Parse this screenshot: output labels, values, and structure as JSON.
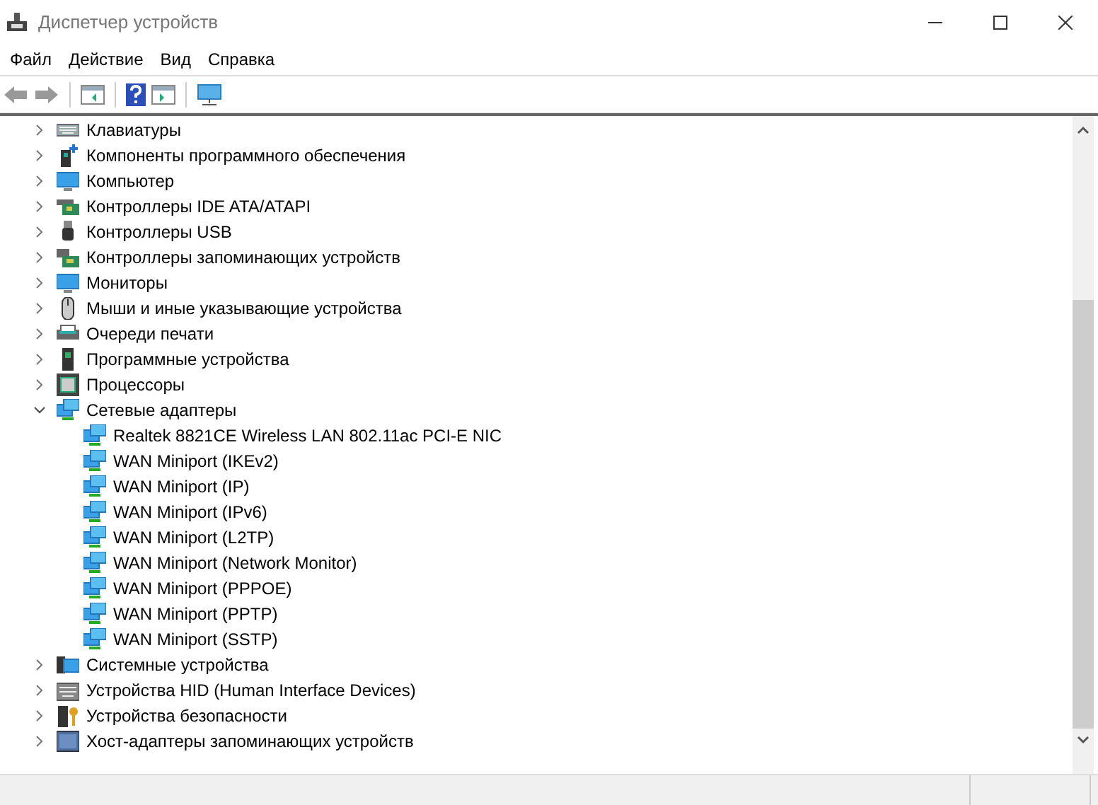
{
  "window": {
    "title": "Диспетчер устройств"
  },
  "menu": [
    "Файл",
    "Действие",
    "Вид",
    "Справка"
  ],
  "tree": [
    {
      "label": "Клавиатуры",
      "expanded": false
    },
    {
      "label": "Компоненты программного обеспечения",
      "expanded": false
    },
    {
      "label": "Компьютер",
      "expanded": false
    },
    {
      "label": "Контроллеры IDE ATA/ATAPI",
      "expanded": false
    },
    {
      "label": "Контроллеры USB",
      "expanded": false
    },
    {
      "label": "Контроллеры запоминающих устройств",
      "expanded": false
    },
    {
      "label": "Мониторы",
      "expanded": false
    },
    {
      "label": "Мыши и иные указывающие устройства",
      "expanded": false
    },
    {
      "label": "Очереди печати",
      "expanded": false
    },
    {
      "label": "Программные устройства",
      "expanded": false
    },
    {
      "label": "Процессоры",
      "expanded": false
    },
    {
      "label": "Сетевые адаптеры",
      "expanded": true,
      "children": [
        {
          "label": "Realtek 8821CE Wireless LAN 802.11ac PCI-E NIC"
        },
        {
          "label": "WAN Miniport (IKEv2)"
        },
        {
          "label": "WAN Miniport (IP)"
        },
        {
          "label": "WAN Miniport (IPv6)"
        },
        {
          "label": "WAN Miniport (L2TP)"
        },
        {
          "label": "WAN Miniport (Network Monitor)"
        },
        {
          "label": "WAN Miniport (PPPOE)"
        },
        {
          "label": "WAN Miniport (PPTP)"
        },
        {
          "label": "WAN Miniport (SSTP)"
        }
      ]
    },
    {
      "label": "Системные устройства",
      "expanded": false
    },
    {
      "label": "Устройства HID (Human Interface Devices)",
      "expanded": false
    },
    {
      "label": "Устройства безопасности",
      "expanded": false
    },
    {
      "label": "Хост-адаптеры запоминающих устройств",
      "expanded": false
    }
  ]
}
